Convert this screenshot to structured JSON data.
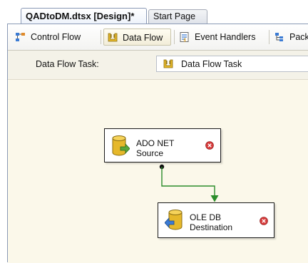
{
  "document_tabs": {
    "active": "QADtoDM.dtsx [Design]*",
    "inactive": "Start Page"
  },
  "designer_tabs": [
    {
      "label": "Control Flow",
      "icon": "control-flow-icon"
    },
    {
      "label": "Data Flow",
      "icon": "data-flow-icon",
      "selected": true
    },
    {
      "label": "Event Handlers",
      "icon": "event-handlers-icon"
    },
    {
      "label": "Packa",
      "icon": "package-explorer-icon"
    }
  ],
  "task_bar": {
    "label": "Data Flow Task:",
    "selected_task": "Data Flow Task"
  },
  "components": [
    {
      "line1": "ADO NET",
      "line2": "Source",
      "status": "error"
    },
    {
      "line1": "OLE DB",
      "line2": "Destination",
      "status": "error"
    }
  ],
  "colors": {
    "canvas": "#fbf8ea",
    "path": "#2a8c2a",
    "error": "#d63a3a",
    "cylinder": "#e6b82a"
  }
}
